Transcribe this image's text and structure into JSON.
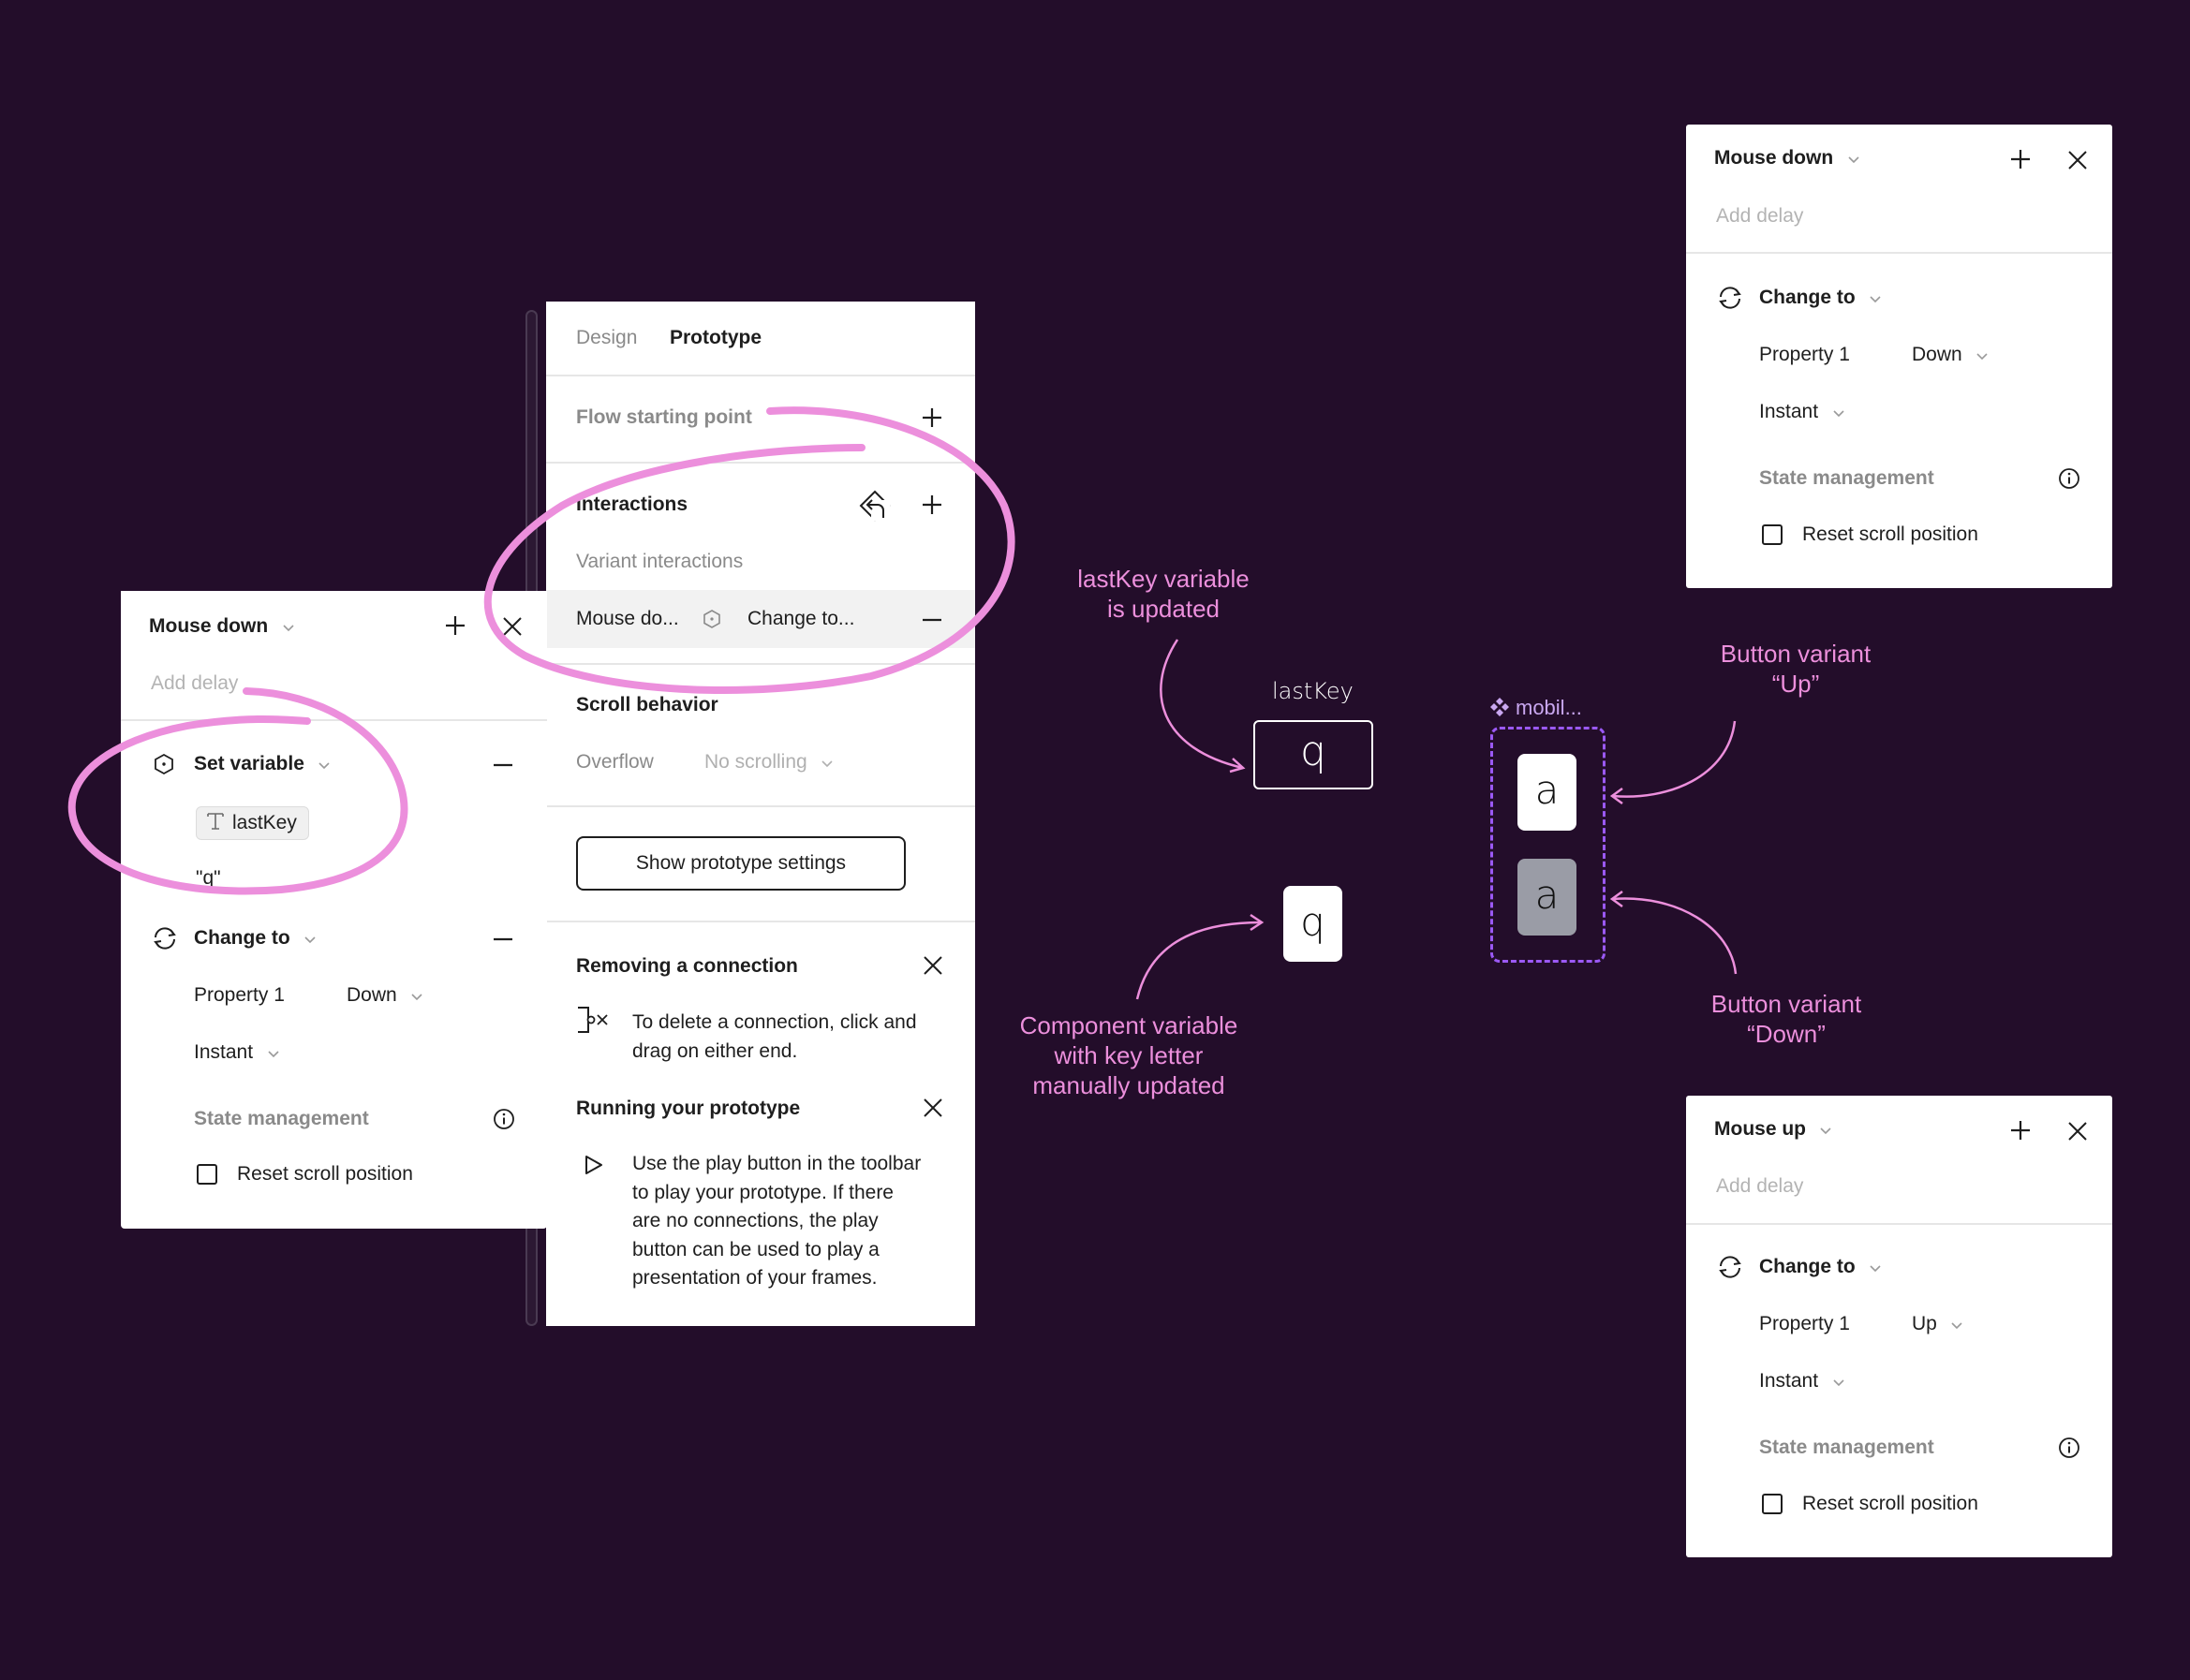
{
  "colors": {
    "background": "#230d2a",
    "annotation_pink": "#ec8fdc",
    "component_purple": "#9b59f5",
    "component_label": "#c9a7f0",
    "key_down_gray": "#9a9ca6"
  },
  "center_panel": {
    "tabs": [
      {
        "label": "Design",
        "active": false
      },
      {
        "label": "Prototype",
        "active": true
      }
    ],
    "flow_starting_point": {
      "label": "Flow starting point",
      "add_icon": "plus-icon"
    },
    "interactions": {
      "title": "Interactions",
      "variant_icon": "variant-interaction-icon",
      "add_icon": "plus-icon",
      "subtitle": "Variant interactions",
      "row": {
        "trigger": "Mouse do...",
        "action_icon": "variable-hexagon-icon",
        "action": "Change to...",
        "remove_icon": "minus-icon"
      }
    },
    "scroll_behavior": {
      "title": "Scroll behavior",
      "overflow_label": "Overflow",
      "overflow_value": "No scrolling"
    },
    "show_settings_button": "Show prototype settings",
    "tips": [
      {
        "title": "Removing a connection",
        "icon": "remove-connection-icon",
        "body_lines": [
          "To delete a connection, click and",
          "drag on either end."
        ]
      },
      {
        "title": "Running your prototype",
        "icon": "play-icon",
        "body_lines": [
          "Use the play button in the toolbar",
          "to play your prototype. If there",
          "are no connections, the play",
          "button can be used to play a",
          "presentation of your frames."
        ]
      }
    ]
  },
  "left_panel": {
    "trigger": "Mouse down",
    "add_delay": "Add delay",
    "set_variable": {
      "label": "Set variable",
      "variable_name": "lastKey",
      "variable_type_icon": "text-type-icon",
      "value": "\"q\""
    },
    "change_to": {
      "label": "Change to",
      "property_label": "Property 1",
      "property_value": "Down",
      "animation": "Instant"
    },
    "state_management": "State management",
    "reset_scroll": "Reset scroll position",
    "reset_scroll_checked": false
  },
  "top_right_panel": {
    "trigger": "Mouse down",
    "add_delay": "Add delay",
    "change_to": {
      "label": "Change to",
      "property_label": "Property 1",
      "property_value": "Down",
      "animation": "Instant"
    },
    "state_management": "State management",
    "reset_scroll": "Reset scroll position",
    "reset_scroll_checked": false
  },
  "bottom_right_panel": {
    "trigger": "Mouse up",
    "add_delay": "Add delay",
    "change_to": {
      "label": "Change to",
      "property_label": "Property 1",
      "property_value": "Up",
      "animation": "Instant"
    },
    "state_management": "State management",
    "reset_scroll": "Reset scroll position",
    "reset_scroll_checked": false
  },
  "canvas": {
    "variable_label": "lastKey",
    "variable_value": "q",
    "key_instance_letter": "q",
    "component_name": "mobil...",
    "variant_up_letter": "a",
    "variant_down_letter": "a"
  },
  "annotations": {
    "variable_updated": [
      "lastKey variable",
      "is updated"
    ],
    "component_variable": [
      "Component variable",
      "with key letter",
      "manually  updated"
    ],
    "variant_up": [
      "Button variant",
      "“Up”"
    ],
    "variant_down": [
      "Button variant",
      "“Down”"
    ]
  }
}
